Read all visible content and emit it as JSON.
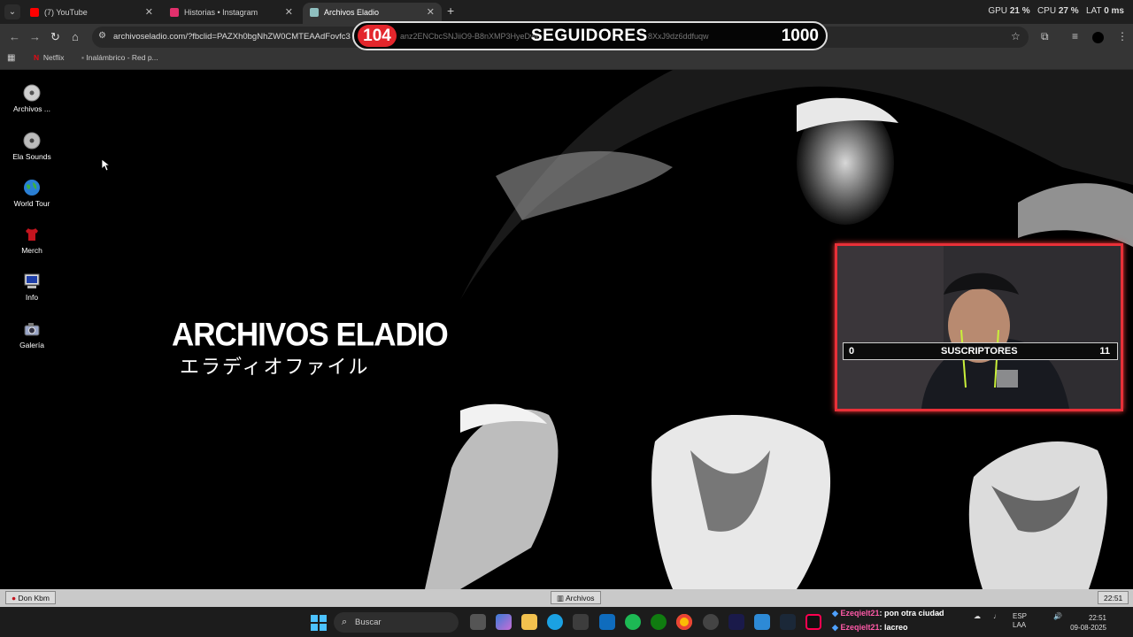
{
  "browser": {
    "tabs": [
      {
        "label": "(7) YouTube",
        "favicon_color": "#ff0000"
      },
      {
        "label": "Historias • Instagram",
        "favicon_color": "#e1306c"
      },
      {
        "label": "Archivos Eladio",
        "favicon_color": "#8fbfbf",
        "active": true
      }
    ],
    "sys_stats": {
      "gpu_label": "GPU",
      "gpu_value": "21 %",
      "cpu_label": "CPU",
      "cpu_value": "27 %",
      "lat_label": "LAT",
      "lat_value": "0 ms"
    },
    "url_host": "archivoseladio.com/?fbclid=PAZXh0bgNhZW0CMTEAAdFovfc3",
    "url_mid": "anz2ENCbcSNJiiO9-B8nXMP3HyeDwi",
    "url_tail": "8XxJ9dz6ddfuqw",
    "bookmarks": [
      {
        "label": "Netflix"
      },
      {
        "label": "Inalámbrico - Red p..."
      }
    ]
  },
  "overlay": {
    "followers_count": "104",
    "followers_label": "SEGUIDORES",
    "followers_goal": "1000",
    "subs_count": "0",
    "subs_label": "SUSCRIPTORES",
    "subs_goal": "11"
  },
  "desktop": {
    "icons": [
      {
        "label": "Archivos ...",
        "icon": "cd-icon"
      },
      {
        "label": "Ela Sounds",
        "icon": "cd-icon"
      },
      {
        "label": "World Tour",
        "icon": "globe-icon"
      },
      {
        "label": "Merch",
        "icon": "shirt-icon"
      },
      {
        "label": "Info",
        "icon": "computer-icon"
      },
      {
        "label": "Galería",
        "icon": "camera-icon"
      }
    ],
    "title": "ARCHIVOS ELADIO",
    "title_jp": "エラディオファイル"
  },
  "retro_taskbar": {
    "start_label": "Don Kbm",
    "window_label": "Archivos",
    "clock": "22:51"
  },
  "windows_taskbar": {
    "search_placeholder": "Buscar",
    "chat": [
      {
        "user": "Ezeqielt21",
        "text": ": pon otra ciudad"
      },
      {
        "user": "Ezeqielt21",
        "text": ": lacreo"
      }
    ],
    "lang_top": "ESP",
    "lang_bottom": "LAA",
    "time": "22:51",
    "date": "09-08-2025"
  }
}
